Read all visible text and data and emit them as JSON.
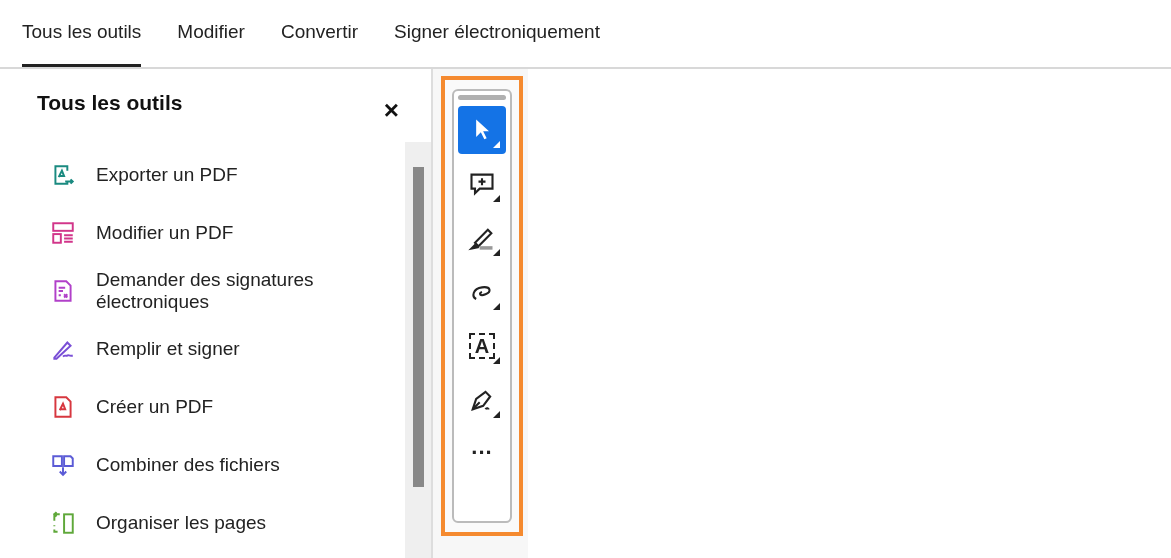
{
  "tabs": [
    {
      "label": "Tous les outils",
      "selected": true
    },
    {
      "label": "Modifier",
      "selected": false
    },
    {
      "label": "Convertir",
      "selected": false
    },
    {
      "label": "Signer électroniquement",
      "selected": false
    }
  ],
  "panel": {
    "title": "Tous les outils",
    "close": "×",
    "items": [
      {
        "label": "Exporter un PDF",
        "kind": "export",
        "color": "#1a8a80"
      },
      {
        "label": "Modifier un PDF",
        "kind": "edit",
        "color": "#d2358a"
      },
      {
        "label": "Demander des signatures électroniques",
        "kind": "request",
        "color": "#b140c9"
      },
      {
        "label": "Remplir et signer",
        "kind": "fill",
        "color": "#7a4fd6"
      },
      {
        "label": "Créer un PDF",
        "kind": "create",
        "color": "#d7373f"
      },
      {
        "label": "Combiner des fichiers",
        "kind": "combine",
        "color": "#5b5bd6"
      },
      {
        "label": "Organiser les pages",
        "kind": "organize",
        "color": "#5fa83a"
      }
    ]
  },
  "toolbar": {
    "tools": [
      {
        "kind": "select",
        "selected": true
      },
      {
        "kind": "comment",
        "selected": false
      },
      {
        "kind": "highlight",
        "selected": false
      },
      {
        "kind": "draw",
        "selected": false
      },
      {
        "kind": "text",
        "glyph": "A",
        "selected": false
      },
      {
        "kind": "sign",
        "selected": false
      }
    ],
    "more": "..."
  }
}
